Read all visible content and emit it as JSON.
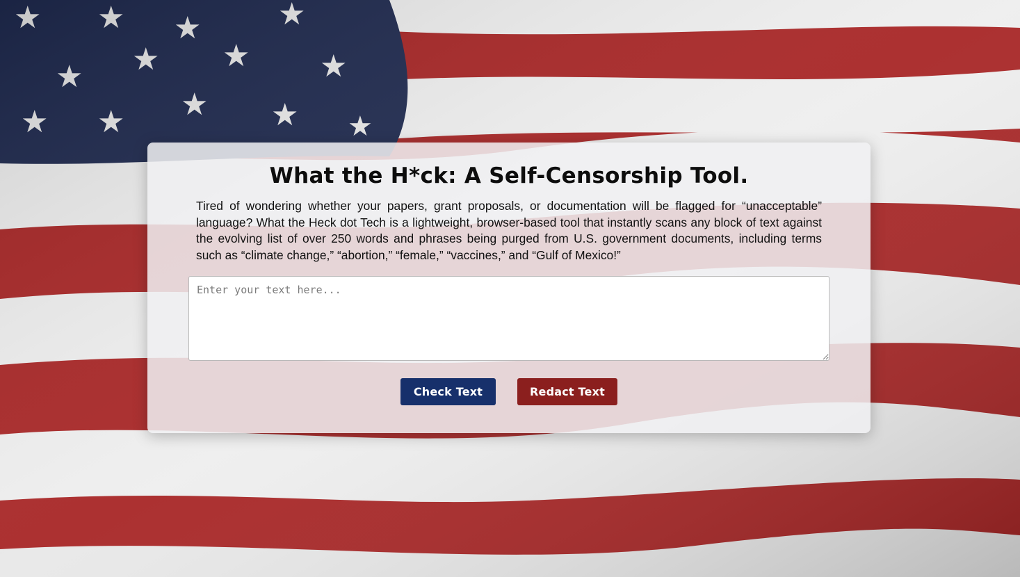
{
  "page": {
    "title": "What the H*ck: A Self-Censorship Tool.",
    "intro": "Tired of wondering whether your papers, grant proposals, or documentation will be flagged for “unacceptable” language? What the Heck dot Tech is a lightweight, browser-based tool that instantly scans any block of text against the evolving list of over 250 words and phrases being purged from U.S. government documents, including terms such as “climate change,” “abortion,” “female,” “vaccines,” and “Gulf of Mexico!”"
  },
  "input": {
    "placeholder": "Enter your text here...",
    "value": ""
  },
  "buttons": {
    "check_label": "Check Text",
    "redact_label": "Redact Text"
  },
  "colors": {
    "check_button": "#17306b",
    "redact_button": "#8b1f1e",
    "flag_red": "#b32a2a",
    "flag_white": "#f2f2f2",
    "flag_blue": "#1f2a4f"
  },
  "background": {
    "icon": "american-flag"
  }
}
